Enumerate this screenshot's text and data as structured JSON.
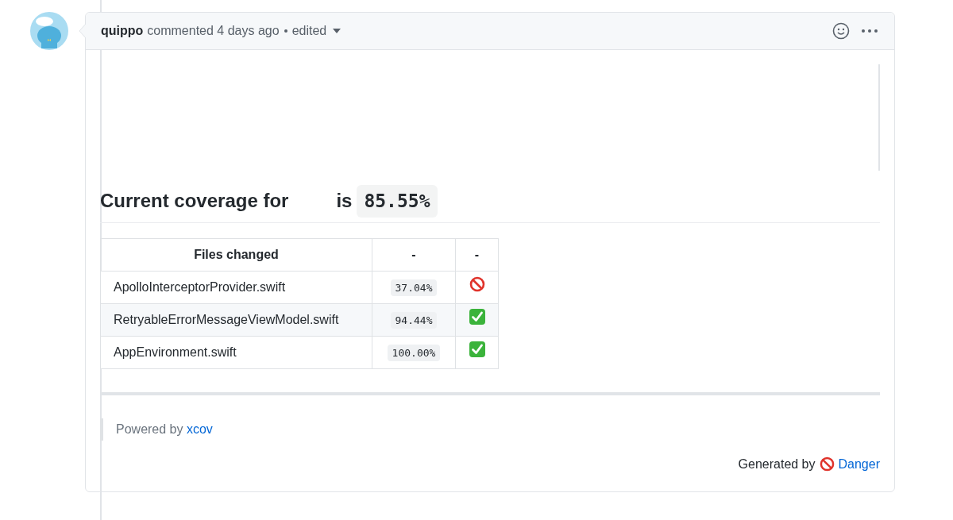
{
  "comment": {
    "author": "quippo",
    "action": "commented 4 days ago",
    "edited": "edited"
  },
  "coverage": {
    "prefix": "Current coverage for",
    "suffix": "is",
    "value": "85.55%"
  },
  "table": {
    "columns": [
      "Files changed",
      "-",
      "-"
    ],
    "rows": [
      {
        "file": "ApolloInterceptorProvider.swift",
        "coverage": "37.04%",
        "status": {
          "kind": "fail"
        }
      },
      {
        "file": "RetryableErrorMessageViewModel.swift",
        "coverage": "94.44%",
        "status": {
          "kind": "pass"
        }
      },
      {
        "file": "AppEnvironment.swift",
        "coverage": "100.00%",
        "status": {
          "kind": "pass"
        }
      }
    ]
  },
  "powered_by": {
    "text": "Powered by",
    "link": "xcov"
  },
  "generated_by": {
    "text": "Generated by",
    "link": "Danger"
  }
}
